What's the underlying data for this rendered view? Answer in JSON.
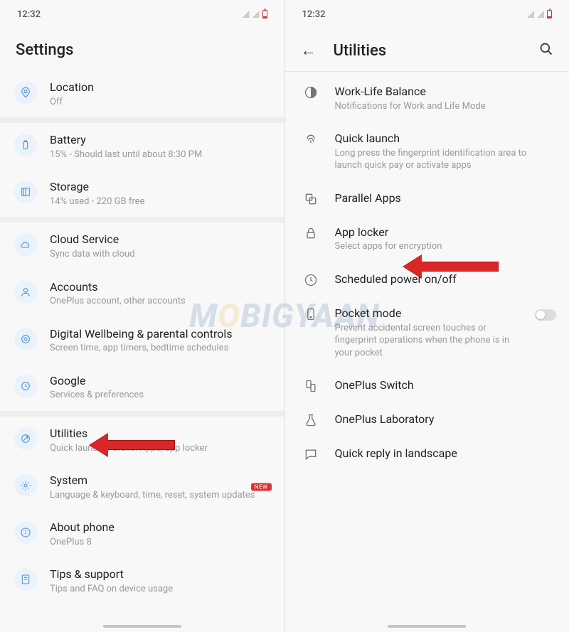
{
  "statusTime": "12:32",
  "left": {
    "title": "Settings",
    "items": {
      "location": {
        "title": "Location",
        "sub": "Off"
      },
      "battery": {
        "title": "Battery",
        "sub": "15% - Should last until about 8:30 PM"
      },
      "storage": {
        "title": "Storage",
        "sub": "14% used - 220 GB free"
      },
      "cloud": {
        "title": "Cloud Service",
        "sub": "Sync data with cloud"
      },
      "accounts": {
        "title": "Accounts",
        "sub": "OnePlus account, other accounts"
      },
      "wellbeing": {
        "title": "Digital Wellbeing & parental controls",
        "sub": "Screen time, app timers, bedtime schedules"
      },
      "google": {
        "title": "Google",
        "sub": "Services & preferences"
      },
      "utilities": {
        "title": "Utilities",
        "sub": "Quick launch, Parallel Apps, app locker"
      },
      "system": {
        "title": "System",
        "sub": "Language & keyboard, time, reset, system updates",
        "badge": "NEW"
      },
      "about": {
        "title": "About phone",
        "sub": "OnePlus 8"
      },
      "tips": {
        "title": "Tips & support",
        "sub": "Tips and FAQ on device usage"
      }
    }
  },
  "right": {
    "title": "Utilities",
    "items": {
      "wlb": {
        "title": "Work-Life Balance",
        "sub": "Notifications for Work and Life Mode"
      },
      "quicklaunch": {
        "title": "Quick launch",
        "sub": "Long press the fingerprint identification area to launch quick pay or activate apps"
      },
      "parallel": {
        "title": "Parallel Apps"
      },
      "applocker": {
        "title": "App locker",
        "sub": "Select apps for encryption"
      },
      "sched": {
        "title": "Scheduled power on/off"
      },
      "pocket": {
        "title": "Pocket mode",
        "sub": "Prevent accidental screen touches or fingerprint operations when the phone is in your pocket"
      },
      "switch": {
        "title": "OnePlus Switch"
      },
      "lab": {
        "title": "OnePlus Laboratory"
      },
      "quickreply": {
        "title": "Quick reply in landscape"
      }
    }
  },
  "watermark": {
    "a": "M",
    "b": "O",
    "c": "BIGYAAN"
  }
}
